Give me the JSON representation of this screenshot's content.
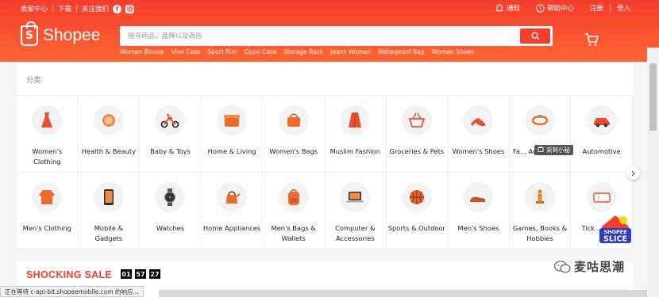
{
  "colors": {
    "brand": "#f53d2d",
    "brand_light": "#ff6633"
  },
  "topbar": {
    "seller_centre": "卖家中心",
    "download": "下载",
    "follow_us": "关注我们",
    "notifications": "通知",
    "help": "帮助中心",
    "sign_up": "注册",
    "login": "登入"
  },
  "header": {
    "logo": "Shopee",
    "search_placeholder": "搜寻商品，品牌以及商店",
    "hot_words": [
      "Women Blouse",
      "Vivo Case",
      "Sport Rim",
      "Oppo Case",
      "Storage Rack",
      "Jeans Women",
      "Waterproof Bag",
      "Women Shoes"
    ]
  },
  "categories": {
    "title": "分类",
    "items": [
      {
        "label": "Women's Clothing",
        "icon": "dress-icon"
      },
      {
        "label": "Health & Beauty",
        "icon": "compact-powder-icon"
      },
      {
        "label": "Baby & Toys",
        "icon": "tricycle-icon"
      },
      {
        "label": "Home & Living",
        "icon": "storage-box-icon"
      },
      {
        "label": "Women's Bags",
        "icon": "handbag-icon"
      },
      {
        "label": "Muslim Fashion",
        "icon": "robe-icon"
      },
      {
        "label": "Groceries & Pets",
        "icon": "basket-icon"
      },
      {
        "label": "Women's Shoes",
        "icon": "high-heel-icon"
      },
      {
        "label": "Fa... Accessories",
        "icon": "bracelet-icon"
      },
      {
        "label": "Automotive",
        "icon": "car-icon"
      },
      {
        "label": "Men's Clothing",
        "icon": "sweater-icon"
      },
      {
        "label": "Mobile & Gadgets",
        "icon": "phone-icon"
      },
      {
        "label": "Watches",
        "icon": "watch-icon"
      },
      {
        "label": "Home Appliances",
        "icon": "kettle-icon"
      },
      {
        "label": "Men's Bags & Wallets",
        "icon": "backpack-icon"
      },
      {
        "label": "Computer & Accessories",
        "icon": "laptop-icon"
      },
      {
        "label": "Sports & Outdoor",
        "icon": "basketball-icon"
      },
      {
        "label": "Men's Shoes",
        "icon": "mens-shoe-icon"
      },
      {
        "label": "Games, Books & Hobbies",
        "icon": "chess-icon"
      },
      {
        "label": "Tick... Vou...",
        "icon": "ticket-icon"
      }
    ]
  },
  "sale": {
    "title": "SHOCKING SALE",
    "timer": [
      "01",
      "57",
      "27"
    ]
  },
  "overlays": {
    "tooltip": "采到小秘",
    "status": "正在等待 c-api-bit.shopeemobile.com 的响应...",
    "badge_top": "SHOPEE",
    "badge_bottom": "SLICE",
    "watermark": "麦咕思潮"
  }
}
